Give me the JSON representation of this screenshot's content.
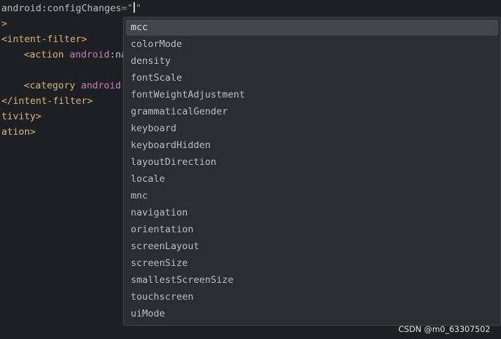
{
  "editor": {
    "line1": {
      "attr_ns": "android",
      "colon": ":",
      "attr_name": "configChanges",
      "equals": "=",
      "quote_open": "\"",
      "quote_close": "\""
    },
    "line2": ">",
    "line3": "<intent-filter>",
    "line4": {
      "tag": "<action",
      "attr": "android",
      "rest": ":na"
    },
    "line6": {
      "tag": "<category",
      "attr": "android",
      "rest": ":"
    },
    "line7": "</intent-filter>",
    "line8": "tivity>",
    "line9": "ation>"
  },
  "completion": {
    "items": [
      "mcc",
      "colorMode",
      "density",
      "fontScale",
      "fontWeightAdjustment",
      "grammaticalGender",
      "keyboard",
      "keyboardHidden",
      "layoutDirection",
      "locale",
      "mnc",
      "navigation",
      "orientation",
      "screenLayout",
      "screenSize",
      "smallestScreenSize",
      "touchscreen",
      "uiMode"
    ],
    "selected_index": 0
  },
  "watermark": "CSDN @m0_63307502",
  "colors": {
    "background": "#1e1f22",
    "popup_background": "#2b2d30",
    "selection": "#43454a",
    "tag": "#d5b778",
    "attribute": "#c77dbb",
    "string": "#6aab73",
    "text": "#bcbec4"
  }
}
